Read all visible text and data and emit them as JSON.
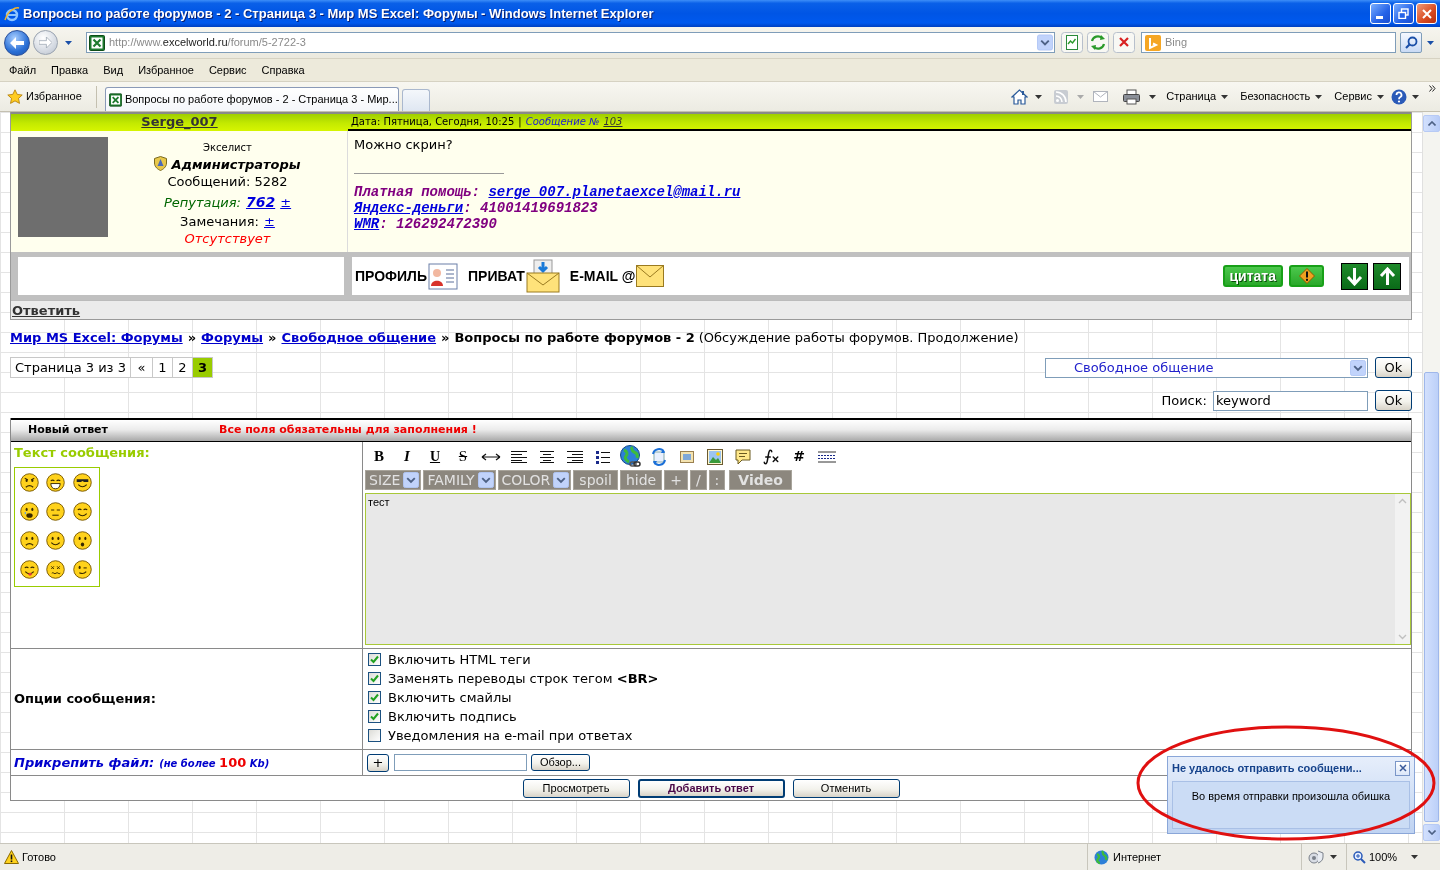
{
  "window": {
    "title": "Вопросы по работе форумов - 2 - Страница 3 - Мир MS Excel: Форумы - Windows Internet Explorer"
  },
  "address_bar": {
    "url": {
      "prefix": "http://www.",
      "domain": "excelworld.ru",
      "path": "/forum/5-2722-3"
    },
    "search": {
      "placeholder": "Bing"
    }
  },
  "menu": [
    {
      "label": "Файл"
    },
    {
      "label": "Правка"
    },
    {
      "label": "Вид"
    },
    {
      "label": "Избранное"
    },
    {
      "label": "Сервис"
    },
    {
      "label": "Справка"
    }
  ],
  "favorites_bar": {
    "favorites": "Избранное",
    "tabs": [
      {
        "label": "Вопросы по работе форумов - 2 - Страница 3 - Мир...",
        "selected": true
      }
    ],
    "commands": [
      {
        "label": "Страница"
      },
      {
        "label": "Безопасность"
      },
      {
        "label": "Сервис"
      }
    ]
  },
  "post": {
    "author": "Serge_007",
    "date": "Дата: Пятница, Сегодня, 10:25",
    "separator": "|",
    "message_label": "Сообщение №",
    "message_number": "103",
    "rank": "Экселист",
    "group": "Администраторы",
    "posts": "Сообщений: 5282",
    "reputation": {
      "label": "Репутация:",
      "value": "762",
      "change": "±"
    },
    "warnings": {
      "label": "Замечания:",
      "change": "±"
    },
    "status": "Отсутствует",
    "text": "Можно скрин?",
    "signature": [
      [
        {
          "text": "Платная помощь: ",
          "link": false
        },
        {
          "text": "serge_007.planetaexcel@mail.ru",
          "link": true
        }
      ],
      [
        {
          "text": "Яндекс-деньги",
          "link": true
        },
        {
          "text": ": 41001419691823",
          "link": false
        }
      ],
      [
        {
          "text": "WMR",
          "link": true
        },
        {
          "text": ": 126292472390",
          "link": false
        }
      ]
    ],
    "actions": [
      {
        "kind": "profile",
        "label": "ПРОФИЛЬ"
      },
      {
        "kind": "private",
        "label": "ПРИВАТ"
      },
      {
        "kind": "email",
        "label": "E-MAIL @"
      }
    ],
    "quote_button": "цитата",
    "reply_link": "Ответить"
  },
  "breadcrumbs": {
    "items": [
      {
        "label": "Мир MS Excel: Форумы",
        "kind": "link",
        "separator": "»"
      },
      {
        "label": "Форумы",
        "kind": "link",
        "separator": "»"
      },
      {
        "label": "Свободное общение",
        "kind": "link",
        "separator": "»"
      },
      {
        "label": "Вопросы по работе форумов - 2",
        "kind": "current"
      }
    ],
    "description": "(Обсуждение работы форумов. Продолжение)"
  },
  "pagination": {
    "label": "Страница 3 из 3",
    "previous": "«",
    "pages": [
      {
        "label": "1",
        "selected": false
      },
      {
        "label": "2",
        "selected": false
      },
      {
        "label": "3",
        "selected": true
      }
    ]
  },
  "forum_jump": {
    "value": "Свободное общение",
    "button": "Ok"
  },
  "search": {
    "label": "Поиск:",
    "value": "keyword",
    "button": "Ok"
  },
  "reply_form": {
    "title": "Новый ответ",
    "notice": "Все поля обязательны для заполнения !",
    "message_label": "Текст сообщения:",
    "toolbar": [
      {
        "kind": "bold",
        "label": "B"
      },
      {
        "kind": "italic",
        "label": "I"
      },
      {
        "kind": "underline",
        "label": "U"
      },
      {
        "kind": "strike",
        "label": "S"
      },
      {
        "kind": "hr"
      },
      {
        "kind": "align-left"
      },
      {
        "kind": "align-center"
      },
      {
        "kind": "align-right"
      },
      {
        "kind": "list"
      },
      {
        "kind": "url"
      },
      {
        "kind": "swap"
      },
      {
        "kind": "thumbnail"
      },
      {
        "kind": "image"
      },
      {
        "kind": "quote"
      },
      {
        "kind": "formula"
      },
      {
        "kind": "hash",
        "label": "#"
      },
      {
        "kind": "rule"
      }
    ],
    "format_controls": [
      {
        "kind": "select",
        "label": "SIZE"
      },
      {
        "kind": "select",
        "label": "FAMILY"
      },
      {
        "kind": "select",
        "label": "COLOR"
      },
      {
        "kind": "button",
        "label": "spoil"
      },
      {
        "kind": "button",
        "label": "hide"
      },
      {
        "kind": "button",
        "label": "+"
      },
      {
        "kind": "button",
        "label": "/"
      },
      {
        "kind": "button",
        "label": ":"
      },
      {
        "kind": "media",
        "label": "Video"
      }
    ],
    "message": "тест",
    "options_label": "Опции сообщения:",
    "options": [
      {
        "label": "Включить HTML теги",
        "checked": true
      },
      {
        "label": "Заменять переводы строк тегом **<BR>**",
        "checked": true
      },
      {
        "label": "Включить смайлы",
        "checked": true
      },
      {
        "label": "Включить подпись",
        "checked": true
      },
      {
        "label": "Уведомления на e-mail при ответах",
        "checked": false
      }
    ],
    "attach": {
      "label": "Прикрепить файл:",
      "note": [
        {
          "text": "(не более",
          "kind": "plain"
        },
        {
          "text": "100",
          "kind": "accent"
        },
        {
          "text": "Kb)",
          "kind": "plain"
        }
      ],
      "add_button": "+",
      "browse_button": "Обзор..."
    },
    "buttons": [
      {
        "label": "Просмотреть",
        "kind": "normal"
      },
      {
        "label": "Добавить ответ",
        "kind": "primary"
      },
      {
        "label": "Отменить",
        "kind": "normal"
      }
    ]
  },
  "notification": {
    "title": "Не удалось отправить сообщени...",
    "message": "Во время отправки произошла обишка"
  },
  "status_bar": {
    "status": "Готово",
    "zone": "Интернет",
    "zoom": "100%"
  }
}
